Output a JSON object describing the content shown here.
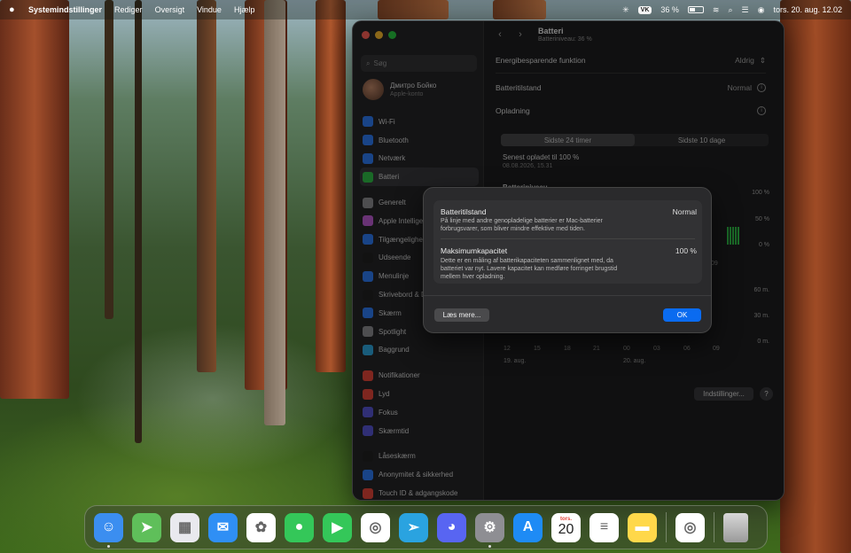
{
  "menubar": {
    "app_name": "Systemindstillinger",
    "menus": [
      "Rediger",
      "Oversigt",
      "Vindue",
      "Hjælp"
    ],
    "vk_badge": "VK",
    "battery_pct": "36 %",
    "clock": "tors. 20. aug.  12.02"
  },
  "window": {
    "search_placeholder": "Søg",
    "profile_name": "Дмитро Бойко",
    "profile_sub": "Apple-konto",
    "sidebar": [
      {
        "label": "Wi-Fi",
        "icon": "wifi-icon",
        "color": "#2f7cf6"
      },
      {
        "label": "Bluetooth",
        "icon": "bluetooth-icon",
        "color": "#2f7cf6"
      },
      {
        "label": "Netværk",
        "icon": "globe-icon",
        "color": "#2f7cf6"
      },
      {
        "label": "Batteri",
        "icon": "battery-icon",
        "color": "#31c048",
        "active": true
      },
      {
        "label": "Generelt",
        "icon": "gear-icon",
        "color": "#8e8e93",
        "gap_before": true
      },
      {
        "label": "Apple Intelligence & Siri",
        "icon": "siri-icon",
        "color": "#c05ed6"
      },
      {
        "label": "Tilgængelighed",
        "icon": "accessibility-icon",
        "color": "#2f7cf6"
      },
      {
        "label": "Udseende",
        "icon": "appearance-icon",
        "color": "#222222"
      },
      {
        "label": "Menulinje",
        "icon": "menubar-icon",
        "color": "#2f7cf6"
      },
      {
        "label": "Skrivebord & Dock",
        "icon": "desktop-icon",
        "color": "#222222"
      },
      {
        "label": "Skærm",
        "icon": "display-icon",
        "color": "#2f7cf6"
      },
      {
        "label": "Spotlight",
        "icon": "spotlight-icon",
        "color": "#8e8e93"
      },
      {
        "label": "Baggrund",
        "icon": "wallpaper-icon",
        "color": "#2fa8e0"
      },
      {
        "label": "Notifikationer",
        "icon": "bell-icon",
        "color": "#e5453a",
        "gap_before": true
      },
      {
        "label": "Lyd",
        "icon": "sound-icon",
        "color": "#e5453a"
      },
      {
        "label": "Fokus",
        "icon": "moon-icon",
        "color": "#5856d6"
      },
      {
        "label": "Skærmtid",
        "icon": "hourglass-icon",
        "color": "#5856d6"
      },
      {
        "label": "Låseskærm",
        "icon": "lock-icon",
        "color": "#222222",
        "gap_before": true
      },
      {
        "label": "Anonymitet & sikkerhed",
        "icon": "hand-icon",
        "color": "#2f7cf6"
      },
      {
        "label": "Touch ID & adgangskode",
        "icon": "fingerprint-icon",
        "color": "#e5453a"
      }
    ],
    "title": "Batteri",
    "subtitle": "Batteriniveau: 36 %",
    "energy_mode_label": "Energibesparende funktion",
    "energy_mode_value": "Aldrig",
    "health_label": "Batteritilstand",
    "health_value": "Normal",
    "charging_label": "Opladning",
    "tabs": [
      "Sidste 24 timer",
      "Sidste 10 dage"
    ],
    "last_charged_label": "Senest opladet til 100 %",
    "last_charged_date": "08.08.2026, 15.31",
    "chart_title": "Batteriniveau",
    "level_ticks": [
      "100 %",
      "50 %",
      "0 %"
    ],
    "time_ticks_upper": [
      "09"
    ],
    "usage_ticks": [
      "60 m.",
      "30 m.",
      "0 m."
    ],
    "hours": [
      "12",
      "15",
      "18",
      "21",
      "00",
      "03",
      "06",
      "09"
    ],
    "dates": [
      "19. aug.",
      "20. aug."
    ],
    "settings_button": "Indstillinger...",
    "help_button": "?"
  },
  "sheet": {
    "health_title": "Batteritilstand",
    "health_value": "Normal",
    "health_desc": "På linje med andre genopladelige batterier er Mac-batterier forbrugsvarer, som bliver mindre effektive med tiden.",
    "capacity_title": "Maksimumkapacitet",
    "capacity_value": "100 %",
    "capacity_desc": "Dette er en måling af batterikapaciteten sammenlignet med, da batteriet var nyt. Lavere kapacitet kan medføre forringet brugstid mellem hver opladning.",
    "learn_more": "Læs mere...",
    "ok": "OK"
  },
  "dock": {
    "calendar_month": "tors.",
    "calendar_day": "20",
    "apps": [
      {
        "name": "finder-icon",
        "color": "#3b8ef0"
      },
      {
        "name": "maps-icon",
        "color": "#5fbf5a"
      },
      {
        "name": "launchpad-icon",
        "color": "#e9e9ee"
      },
      {
        "name": "mail-icon",
        "color": "#2f8ff5"
      },
      {
        "name": "photos-icon",
        "color": "#ffffff"
      },
      {
        "name": "messages-icon",
        "color": "#34c759"
      },
      {
        "name": "facetime-icon",
        "color": "#34c759"
      },
      {
        "name": "chrome-icon",
        "color": "#ffffff"
      },
      {
        "name": "telegram-icon",
        "color": "#2aa3e0"
      },
      {
        "name": "discord-icon",
        "color": "#5865f2"
      },
      {
        "name": "system-settings-icon",
        "color": "#8e8e93"
      },
      {
        "name": "app-store-icon",
        "color": "#1e8bf5"
      },
      {
        "name": "calendar-icon",
        "color": "#ffffff"
      },
      {
        "name": "reminders-icon",
        "color": "#ffffff"
      },
      {
        "name": "notes-icon",
        "color": "#ffd84a"
      }
    ]
  }
}
